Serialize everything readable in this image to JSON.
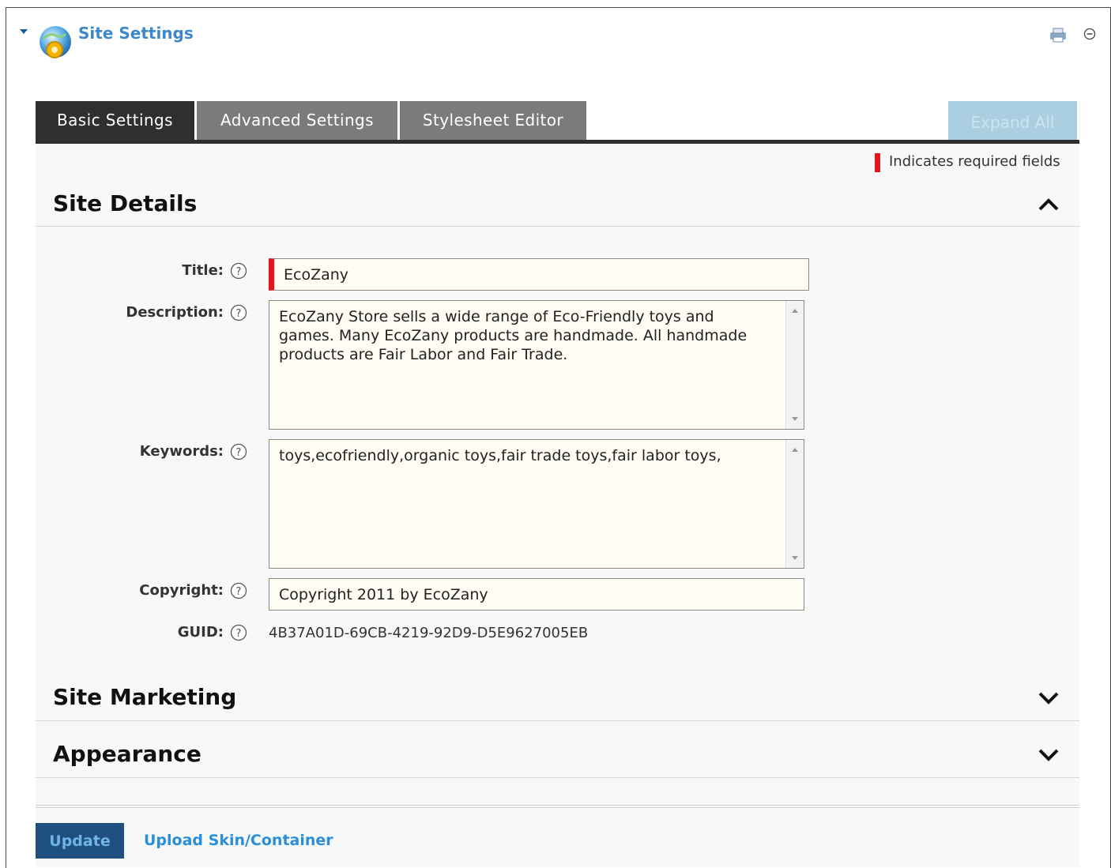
{
  "module": {
    "title": "Site Settings",
    "icons": [
      "collapse-arrow-icon",
      "globe-settings-icon",
      "print-icon",
      "minimize-icon"
    ]
  },
  "tabs": [
    {
      "label": "Basic Settings",
      "active": true
    },
    {
      "label": "Advanced Settings",
      "active": false
    },
    {
      "label": "Stylesheet Editor",
      "active": false
    }
  ],
  "expand_all_label": "Expand All",
  "required_note": "Indicates required fields",
  "sections": {
    "site_details": {
      "title": "Site Details",
      "expanded": true
    },
    "site_marketing": {
      "title": "Site Marketing",
      "expanded": false
    },
    "appearance": {
      "title": "Appearance",
      "expanded": false
    }
  },
  "fields": {
    "title": {
      "label": "Title:",
      "value": "EcoZany",
      "required": true
    },
    "description": {
      "label": "Description:",
      "value": "EcoZany Store sells a wide range of Eco-Friendly toys and games. Many EcoZany products are handmade. All handmade products are Fair Labor and Fair Trade."
    },
    "keywords": {
      "label": "Keywords:",
      "value": "toys,ecofriendly,organic toys,fair trade toys,fair labor toys,"
    },
    "copyright": {
      "label": "Copyright:",
      "value": "Copyright 2011 by EcoZany"
    },
    "guid": {
      "label": "GUID:",
      "value": "4B37A01D-69CB-4219-92D9-D5E9627005EB"
    }
  },
  "actions": {
    "update_label": "Update",
    "upload_label": "Upload Skin/Container"
  },
  "colors": {
    "required": "#e8141b",
    "link": "#2a8fd6",
    "tab_active": "#2f2f2f",
    "tab_inactive": "#7b7b7b",
    "field_bg": "#fffdf4"
  }
}
